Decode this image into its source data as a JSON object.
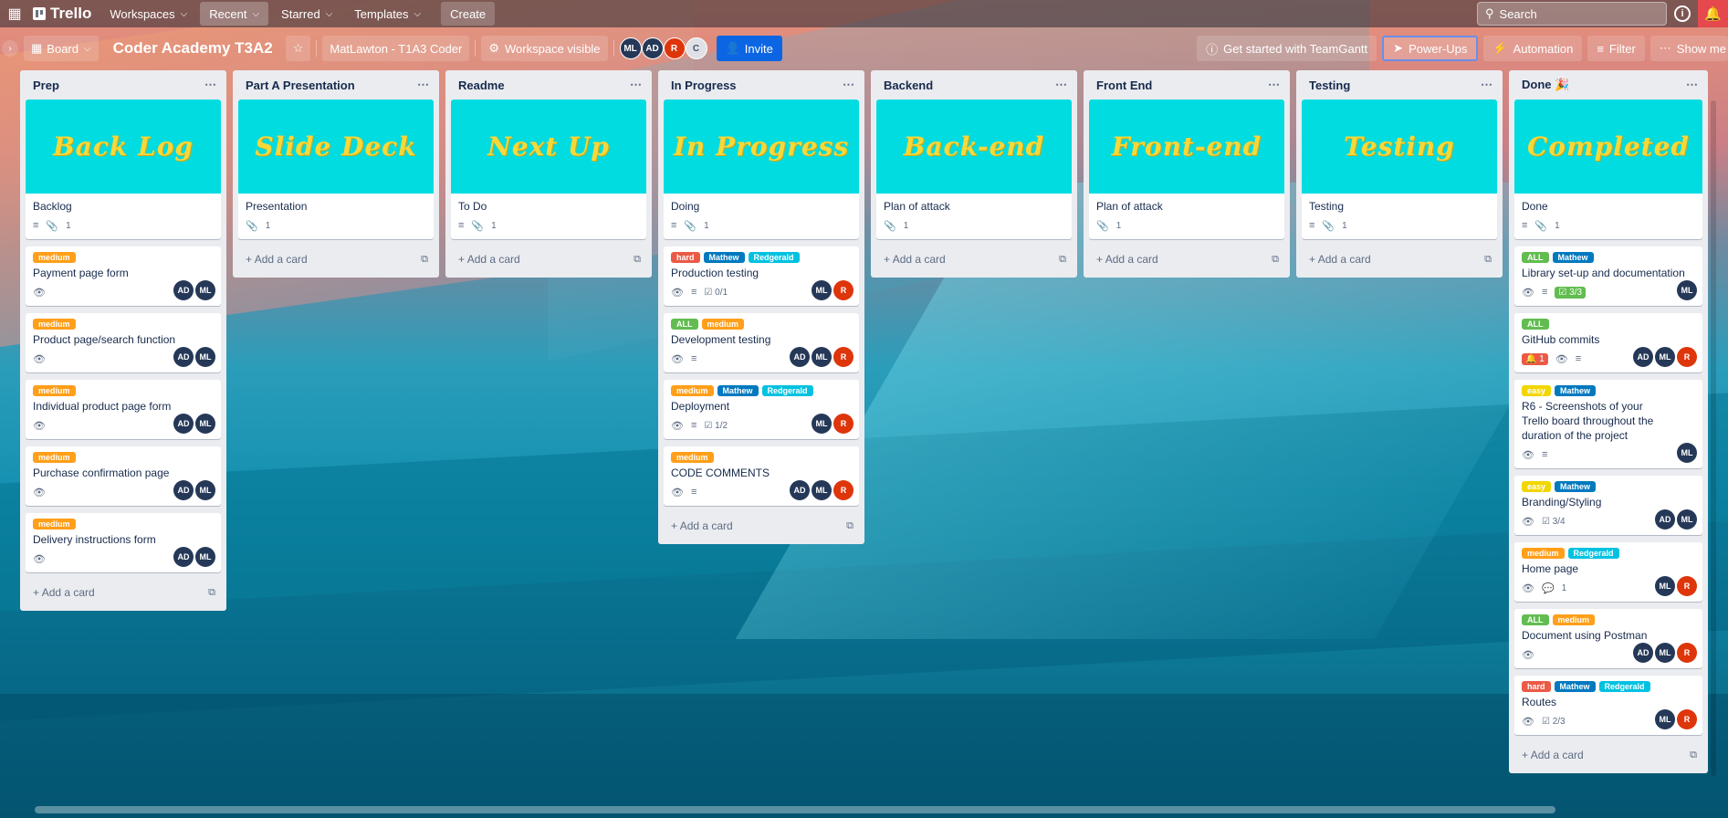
{
  "topbar": {
    "logo": "Trello",
    "nav": [
      {
        "label": "Workspaces",
        "active": false
      },
      {
        "label": "Recent",
        "active": true
      },
      {
        "label": "Starred",
        "active": false
      },
      {
        "label": "Templates",
        "active": false
      }
    ],
    "create": "Create",
    "search_placeholder": "Search",
    "info": "i"
  },
  "boardbar": {
    "view": "Board",
    "title": "Coder Academy T3A2",
    "workspace": "MatLawton - T1A3 Coder",
    "visibility": "Workspace visible",
    "members": [
      "ML",
      "AD",
      "R",
      "C"
    ],
    "invite": "Invite",
    "tools": [
      "Get started with TeamGantt",
      "Power-Ups",
      "Automation",
      "Filter",
      "Show me"
    ]
  },
  "lists": [
    {
      "title": "Prep",
      "cover": "Back Log",
      "cover_card": "Backlog",
      "add": "Add a card",
      "cards": [
        {
          "labels": [
            "medium"
          ],
          "title": "Payment page form",
          "members": [
            "AD",
            "ML"
          ]
        },
        {
          "labels": [
            "medium"
          ],
          "title": "Product page/search function",
          "members": [
            "AD",
            "ML"
          ]
        },
        {
          "labels": [
            "medium"
          ],
          "title": "Individual product page form",
          "members": [
            "AD",
            "ML"
          ]
        },
        {
          "labels": [
            "medium"
          ],
          "title": "Purchase confirmation page",
          "members": [
            "AD",
            "ML"
          ]
        },
        {
          "labels": [
            "medium"
          ],
          "title": "Delivery instructions form",
          "members": [
            "AD",
            "ML"
          ]
        }
      ]
    },
    {
      "title": "Part A Presentation",
      "cover": "Slide Deck",
      "cover_card": "Presentation",
      "add": "Add a card",
      "cards": []
    },
    {
      "title": "Readme",
      "cover": "Next Up",
      "cover_card": "To Do",
      "add": "Add a card",
      "cards": []
    },
    {
      "title": "In Progress",
      "cover": "In Progress",
      "cover_card": "Doing",
      "add": "Add a card",
      "cards": [
        {
          "labels": [
            "hard",
            "Mathew",
            "Redgerald"
          ],
          "title": "Production testing",
          "check": "0/1",
          "members": [
            "ML",
            "R"
          ]
        },
        {
          "labels": [
            "ALL",
            "medium"
          ],
          "title": "Development testing",
          "members": [
            "AD",
            "ML",
            "R"
          ]
        },
        {
          "labels": [
            "medium",
            "Mathew",
            "Redgerald"
          ],
          "title": "Deployment",
          "check": "1/2",
          "members": [
            "ML",
            "R"
          ]
        },
        {
          "labels": [
            "medium"
          ],
          "title": "CODE COMMENTS",
          "members": [
            "AD",
            "ML",
            "R"
          ]
        }
      ]
    },
    {
      "title": "Backend",
      "cover": "Back-end",
      "cover_card": "Plan of attack",
      "add": "Add a card",
      "cards": []
    },
    {
      "title": "Front End",
      "cover": "Front-end",
      "cover_card": "Plan of attack",
      "add": "Add a card",
      "cards": []
    },
    {
      "title": "Testing",
      "cover": "Testing",
      "cover_card": "Testing",
      "add": "Add a card",
      "cards": []
    },
    {
      "title": "Done 🎉",
      "cover": "Completed",
      "cover_card": "Done",
      "add": "Add a card",
      "cards": [
        {
          "labels": [
            "ALL",
            "Mathew"
          ],
          "title": "Library set-up and documentation",
          "check": "3/3",
          "members": [
            "ML"
          ]
        },
        {
          "labels": [
            "ALL"
          ],
          "title": "GitHub commits",
          "notif": "1",
          "members": [
            "AD",
            "ML",
            "R"
          ]
        },
        {
          "labels": [
            "easy",
            "Mathew"
          ],
          "title": "R6 - Screenshots of your Trello board throughout the duration of the project",
          "members": [
            "ML"
          ]
        },
        {
          "labels": [
            "easy",
            "Mathew"
          ],
          "title": "Branding/Styling",
          "check": "3/4",
          "members": [
            "AD",
            "ML"
          ]
        },
        {
          "labels": [
            "medium",
            "Redgerald"
          ],
          "title": "Home page",
          "comments": "1",
          "members": [
            "ML",
            "R"
          ]
        },
        {
          "labels": [
            "ALL",
            "medium"
          ],
          "title": "Document using Postman",
          "members": [
            "AD",
            "ML",
            "R"
          ]
        },
        {
          "labels": [
            "hard",
            "Mathew",
            "Redgerald"
          ],
          "title": "Routes",
          "check": "2/3",
          "members": [
            "ML",
            "R"
          ]
        }
      ]
    }
  ],
  "attachment_count": "1",
  "colors": {
    "cover": "#00dce0",
    "cover_text": "#f5d83a",
    "invite": "#0c66e4",
    "medium": "#ff9f1a",
    "hard": "#eb5a46",
    "easy": "#f2d600",
    "all": "#61bd4f",
    "mathew": "#0079bf",
    "redgerald": "#00c2e0"
  }
}
